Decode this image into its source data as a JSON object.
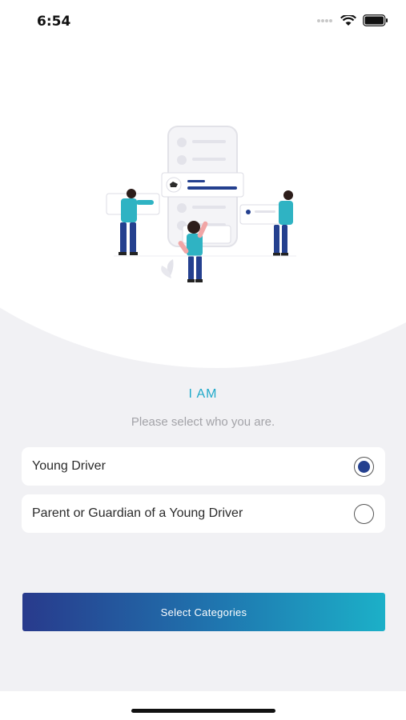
{
  "status_bar": {
    "time": "6:54"
  },
  "heading": "I AM",
  "subheading": "Please select who you are.",
  "options": [
    {
      "label": "Young Driver",
      "selected": true
    },
    {
      "label": "Parent or Guardian of a Young Driver",
      "selected": false
    }
  ],
  "cta": {
    "label": "Select Categories"
  },
  "colors": {
    "accent": "#1fa9c9",
    "radio_selected": "#24408f",
    "gradient_start": "#283a8c",
    "gradient_end": "#1cb0c8"
  }
}
